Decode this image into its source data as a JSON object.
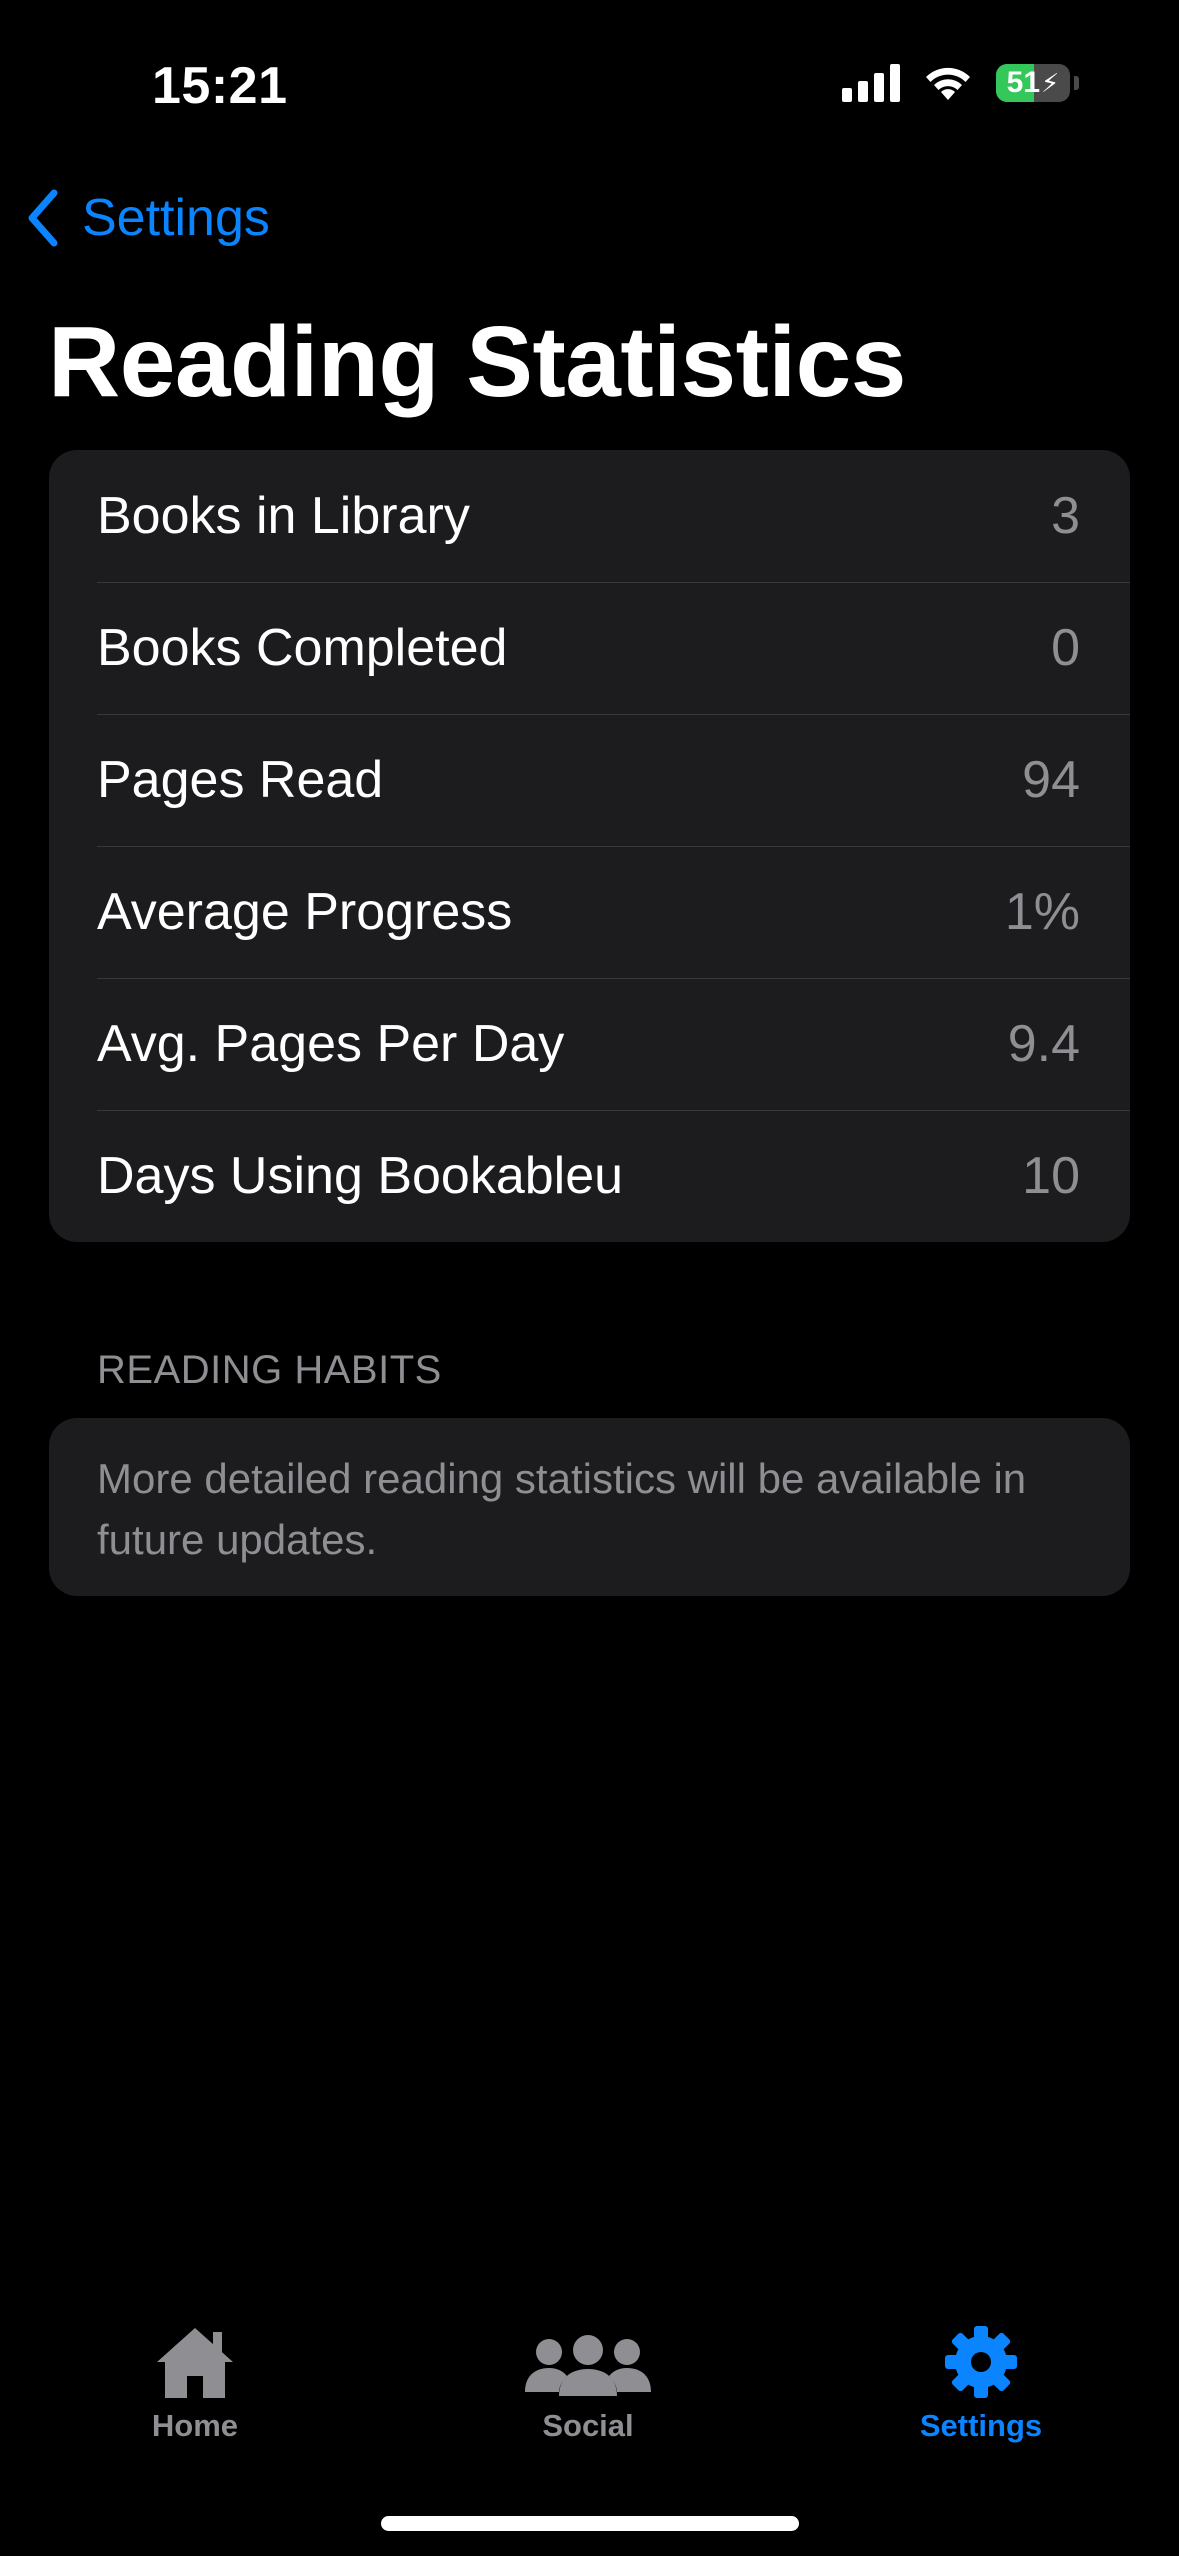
{
  "status_bar": {
    "time": "15:21",
    "battery_level": "51",
    "battery_fraction": 0.51,
    "icons": [
      "cellular-signal-icon",
      "wifi-icon",
      "battery-charging-icon"
    ]
  },
  "nav": {
    "back_label": "Settings",
    "back_icon": "chevron-left-icon",
    "title": "Reading Statistics"
  },
  "stats": [
    {
      "label": "Books in Library",
      "value": "3"
    },
    {
      "label": "Books Completed",
      "value": "0"
    },
    {
      "label": "Pages Read",
      "value": "94"
    },
    {
      "label": "Average Progress",
      "value": "1%"
    },
    {
      "label": "Avg. Pages Per Day",
      "value": "9.4"
    },
    {
      "label": "Days Using Bookableu",
      "value": "10"
    }
  ],
  "reading_habits": {
    "header": "READING HABITS",
    "message": "More detailed reading statistics will be available in future updates."
  },
  "tab_bar": {
    "tabs": [
      {
        "label": "Home",
        "icon": "house-icon",
        "active": false
      },
      {
        "label": "Social",
        "icon": "people-icon",
        "active": false
      },
      {
        "label": "Settings",
        "icon": "gear-icon",
        "active": true
      }
    ]
  },
  "colors": {
    "background": "#000000",
    "card": "#1c1c1e",
    "accent": "#0a84ff",
    "secondary_text": "#8e8e93",
    "battery_green": "#34c759"
  }
}
